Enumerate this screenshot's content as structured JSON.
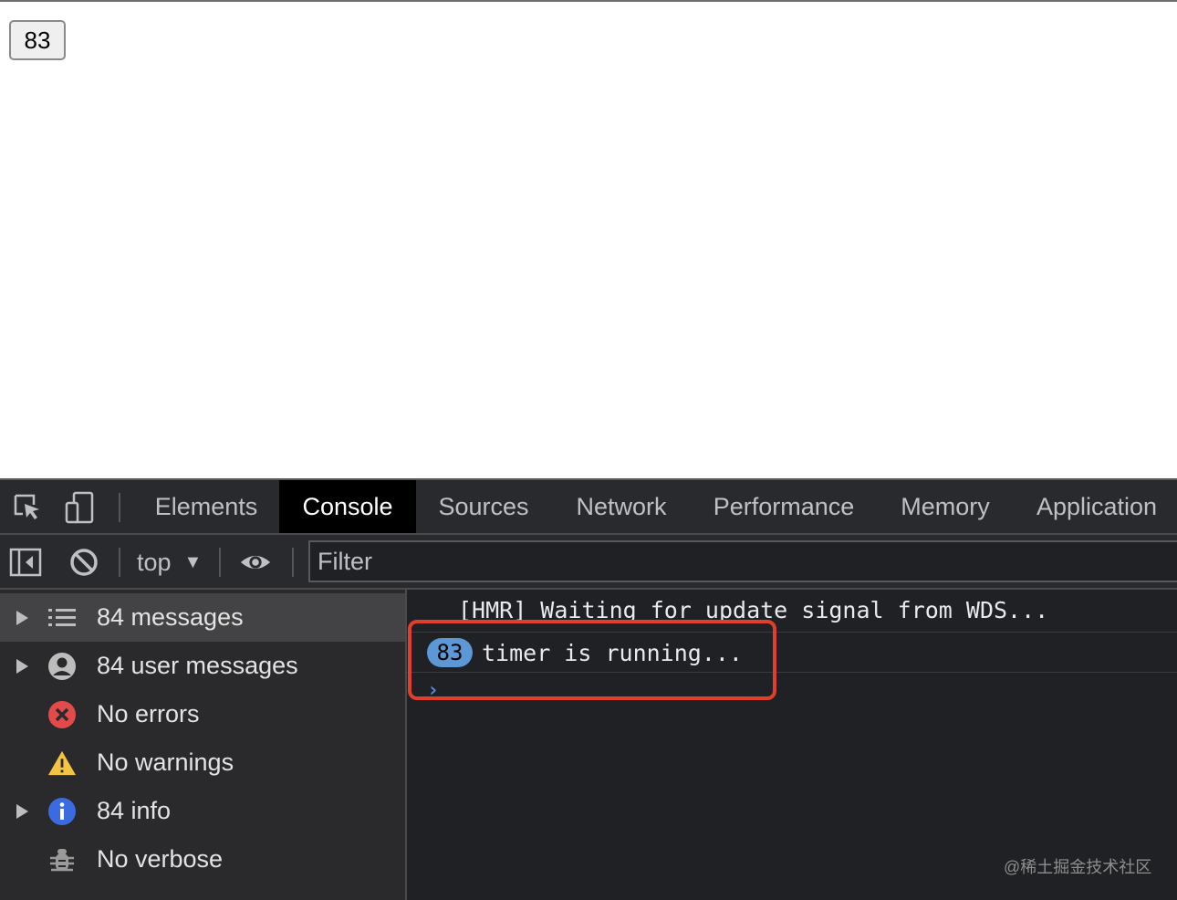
{
  "page": {
    "counter_button": "83"
  },
  "devtools": {
    "tabs": [
      {
        "label": "Elements",
        "active": false
      },
      {
        "label": "Console",
        "active": true
      },
      {
        "label": "Sources",
        "active": false
      },
      {
        "label": "Network",
        "active": false
      },
      {
        "label": "Performance",
        "active": false
      },
      {
        "label": "Memory",
        "active": false
      },
      {
        "label": "Application",
        "active": false
      }
    ],
    "toolbar": {
      "context": "top",
      "filter_placeholder": "Filter"
    },
    "sidebar": {
      "items": [
        {
          "label": "84 messages",
          "icon": "list-icon",
          "expandable": true,
          "selected": true
        },
        {
          "label": "84 user messages",
          "icon": "user-icon",
          "expandable": true,
          "selected": false
        },
        {
          "label": "No errors",
          "icon": "error-icon",
          "expandable": false,
          "selected": false
        },
        {
          "label": "No warnings",
          "icon": "warning-icon",
          "expandable": false,
          "selected": false
        },
        {
          "label": "84 info",
          "icon": "info-icon",
          "expandable": true,
          "selected": false
        },
        {
          "label": "No verbose",
          "icon": "bug-icon",
          "expandable": false,
          "selected": false
        }
      ]
    },
    "console": {
      "lines": [
        {
          "text": "[HMR] Waiting for update signal from WDS..."
        },
        {
          "repeat_count": "83",
          "text": "timer is running..."
        }
      ],
      "prompt": "›"
    },
    "colors": {
      "highlight": "#e0402a",
      "badge": "#5c97d6",
      "prompt": "#4a8cf0"
    }
  },
  "watermark": "@稀土掘金技术社区"
}
